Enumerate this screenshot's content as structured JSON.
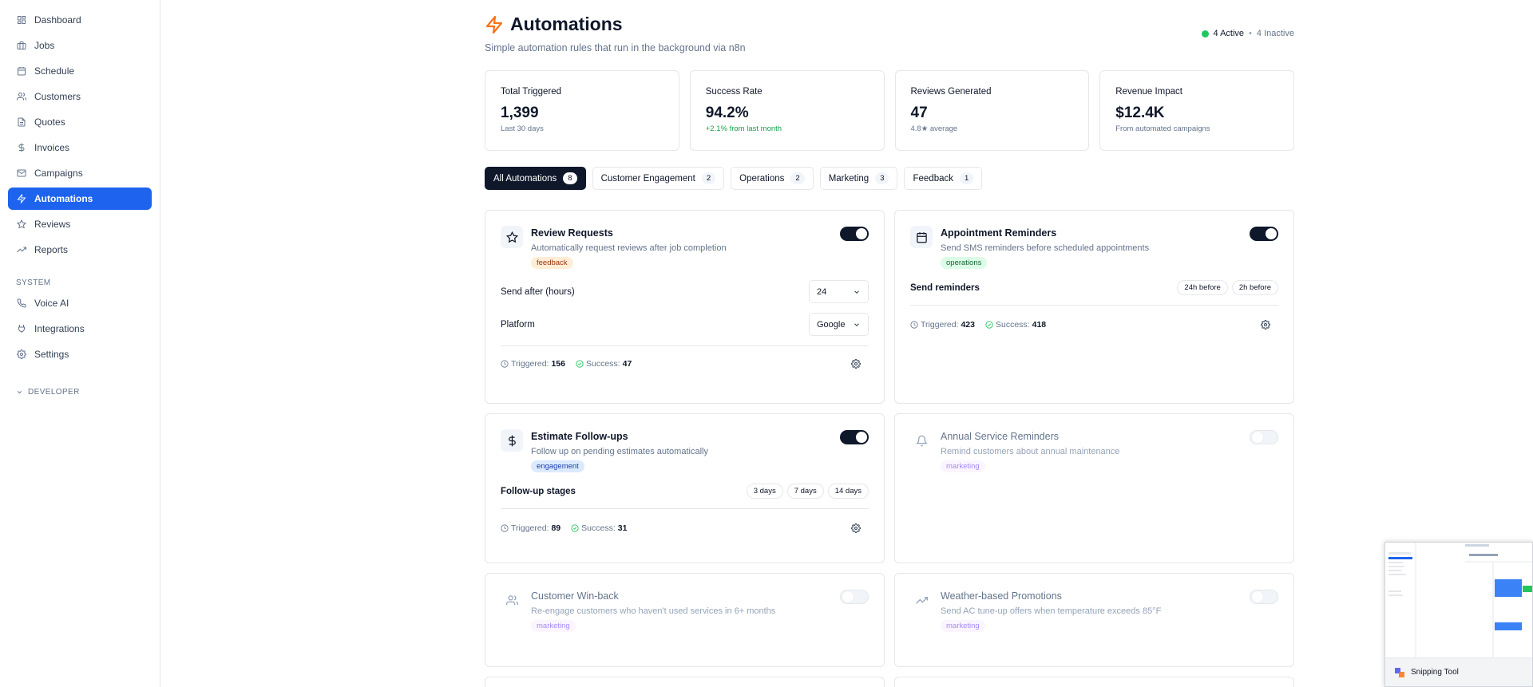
{
  "sidebar": {
    "items": [
      {
        "label": "Dashboard",
        "icon": "dashboard-icon"
      },
      {
        "label": "Jobs",
        "icon": "briefcase-icon"
      },
      {
        "label": "Schedule",
        "icon": "calendar-icon"
      },
      {
        "label": "Customers",
        "icon": "users-icon"
      },
      {
        "label": "Quotes",
        "icon": "document-icon"
      },
      {
        "label": "Invoices",
        "icon": "dollar-icon"
      },
      {
        "label": "Campaigns",
        "icon": "mail-icon"
      },
      {
        "label": "Automations",
        "icon": "lightning-icon",
        "active": true
      },
      {
        "label": "Reviews",
        "icon": "star-icon"
      },
      {
        "label": "Reports",
        "icon": "trending-up-icon"
      }
    ],
    "system_heading": "SYSTEM",
    "system_items": [
      {
        "label": "Voice AI",
        "icon": "phone-icon"
      },
      {
        "label": "Integrations",
        "icon": "plug-icon"
      },
      {
        "label": "Settings",
        "icon": "gear-icon"
      }
    ],
    "developer_label": "DEVELOPER"
  },
  "header": {
    "title": "Automations",
    "subtitle": "Simple automation rules that run in the background via n8n",
    "active_count": "4 Active",
    "inactive_count": "4 Inactive",
    "separator": "•",
    "accent_color": "#f97316"
  },
  "stats": [
    {
      "label": "Total Triggered",
      "value": "1,399",
      "sub": "Last 30 days"
    },
    {
      "label": "Success Rate",
      "value": "94.2%",
      "sub": "+2.1% from last month"
    },
    {
      "label": "Reviews Generated",
      "value": "47",
      "sub": "4.8★ average"
    },
    {
      "label": "Revenue Impact",
      "value": "$12.4K",
      "sub": "From automated campaigns"
    }
  ],
  "tabs": [
    {
      "label": "All Automations",
      "count": "8"
    },
    {
      "label": "Customer Engagement",
      "count": "2"
    },
    {
      "label": "Operations",
      "count": "2"
    },
    {
      "label": "Marketing",
      "count": "3"
    },
    {
      "label": "Feedback",
      "count": "1"
    }
  ],
  "cards": {
    "review": {
      "title": "Review Requests",
      "desc": "Automatically request reviews after job completion",
      "tag": "feedback",
      "enabled": true,
      "setting1_label": "Send after (hours)",
      "setting1_value": "24",
      "setting2_label": "Platform",
      "setting2_value": "Google",
      "triggered_label": "Triggered:",
      "triggered": "156",
      "success_label": "Success:",
      "success": "47"
    },
    "appointment": {
      "title": "Appointment Reminders",
      "desc": "Send SMS reminders before scheduled appointments",
      "tag": "operations",
      "enabled": true,
      "setting_label": "Send reminders",
      "pills": [
        "24h before",
        "2h before"
      ],
      "triggered_label": "Triggered:",
      "triggered": "423",
      "success_label": "Success:",
      "success": "418"
    },
    "estimate": {
      "title": "Estimate Follow-ups",
      "desc": "Follow up on pending estimates automatically",
      "tag": "engagement",
      "enabled": true,
      "setting_label": "Follow-up stages",
      "pills": [
        "3 days",
        "7 days",
        "14 days"
      ],
      "triggered_label": "Triggered:",
      "triggered": "89",
      "success_label": "Success:",
      "success": "31"
    },
    "annual": {
      "title": "Annual Service Reminders",
      "desc": "Remind customers about annual maintenance",
      "tag": "marketing",
      "enabled": false
    },
    "winback": {
      "title": "Customer Win-back",
      "desc": "Re-engage customers who haven't used services in 6+ months",
      "tag": "marketing",
      "enabled": false
    },
    "weather": {
      "title": "Weather-based Promotions",
      "desc": "Send AC tune-up offers when temperature exceeds 85°F",
      "tag": "marketing",
      "enabled": false
    }
  },
  "snipping_tool": {
    "label": "Snipping Tool"
  }
}
